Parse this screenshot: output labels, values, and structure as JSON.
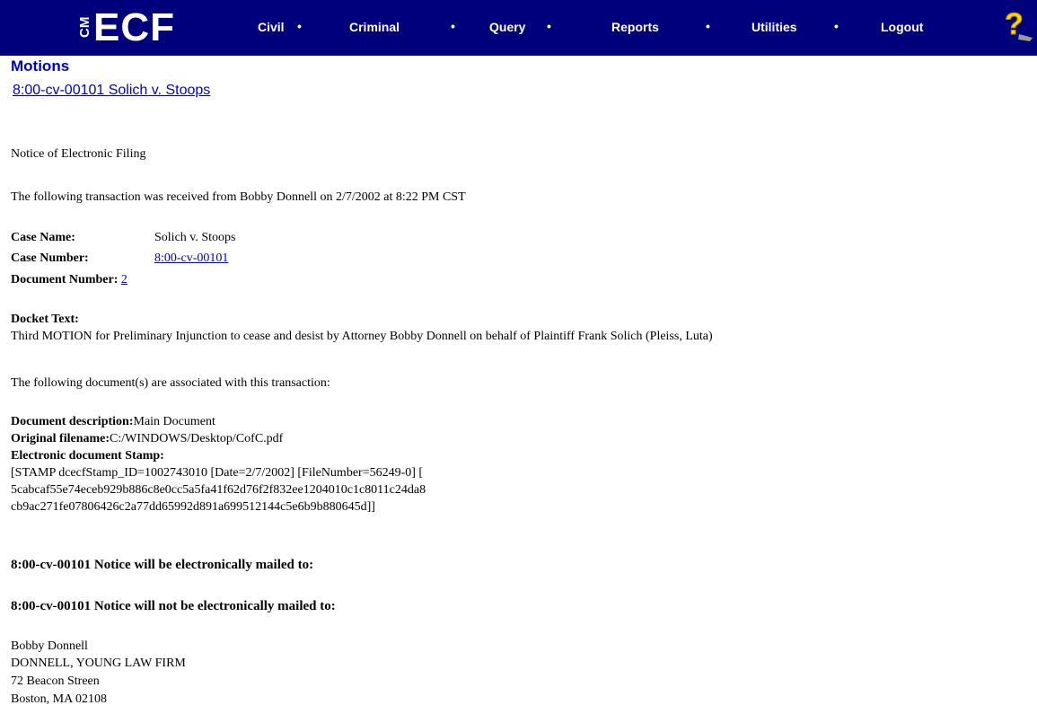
{
  "nav": {
    "logo_cm": "CM",
    "logo_ecf": "ECF",
    "items": [
      "Civil",
      "Criminal",
      "Query",
      "Reports",
      "Utilities",
      "Logout"
    ],
    "separator": "•",
    "help_icon": "help-question-icon",
    "bar_color": "#00007d"
  },
  "header": {
    "title": "Motions",
    "case_link": "8:00-cv-00101 Solich v. Stoops"
  },
  "notice": {
    "heading": "Notice of Electronic Filing",
    "transaction_line": "The following transaction was received from Bobby Donnell on 2/7/2002 at 8:22 PM CST",
    "case_name_label": "Case Name:",
    "case_name_value": "Solich v. Stoops",
    "case_number_label": "Case Number:",
    "case_number_value": "8:00-cv-00101",
    "document_number_label": "Document Number:",
    "document_number_value": "2",
    "docket_text_label": "Docket Text:",
    "docket_text_value": "Third MOTION for Preliminary Injunction to cease and desist by Attorney Bobby Donnell on behalf of Plaintiff Frank Solich (Pleiss, Luta)",
    "associated_docs_line": "The following document(s) are associated with this transaction:",
    "doc_description_label": "Document description:",
    "doc_description_value": "Main Document",
    "original_filename_label": "Original filename:",
    "original_filename_value": "C:/WINDOWS/Desktop/CofC.pdf",
    "stamp_label": "Electronic document Stamp:",
    "stamp_lines": [
      "[STAMP dcecfStamp_ID=1002743010 [Date=2/7/2002] [FileNumber=56249-0] [",
      "5cabcaf55e74eceb929b886c8e0cc5a5fa41f62d76f2f832ee1204010c1c8011c24da8",
      "cb9ac271fe07806426c2a77dd65992d891a699512144c5e6b9b880645d]]"
    ],
    "mailed_heading": "8:00-cv-00101 Notice will be electronically mailed to:",
    "not_mailed_heading": "8:00-cv-00101 Notice will not be electronically mailed to:",
    "recipient_lines": [
      "Bobby Donnell",
      "DONNELL, YOUNG LAW FIRM",
      "72 Beacon Streen",
      "Boston, MA 02108"
    ]
  }
}
